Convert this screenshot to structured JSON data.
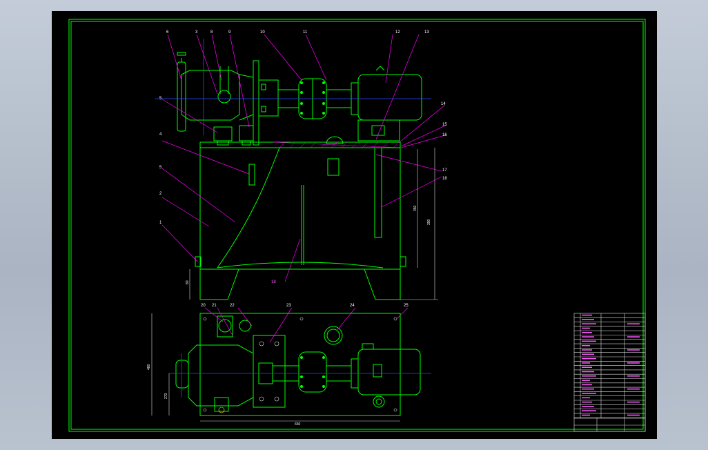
{
  "colors": {
    "background": "#000000",
    "frame": "#00ff00",
    "centerline": "#2a4cff",
    "leader": "#ff00ff",
    "dimension": "#ffffff"
  },
  "part_labels": {
    "p1": "1",
    "p2": "2",
    "p3": "3",
    "p4": "4",
    "p5": "5",
    "p6": "6",
    "p7": "3",
    "p8": "8",
    "p9": "9",
    "p10": "10",
    "p11": "11",
    "p12": "12",
    "p13": "13",
    "p14": "14",
    "p15": "15",
    "p16": "16",
    "p17": "17",
    "p18": "18",
    "p19": "5",
    "p20": "20",
    "p21": "21",
    "p22": "22",
    "p23": "23",
    "p24": "24",
    "p25": "25"
  },
  "annotations": {
    "tank_bottom": "18"
  },
  "dimensions": {
    "tank_height": "390",
    "inner_height": "350",
    "leg_height": "80",
    "base_length": "650",
    "base_width": "480",
    "pump_offset": "270"
  }
}
